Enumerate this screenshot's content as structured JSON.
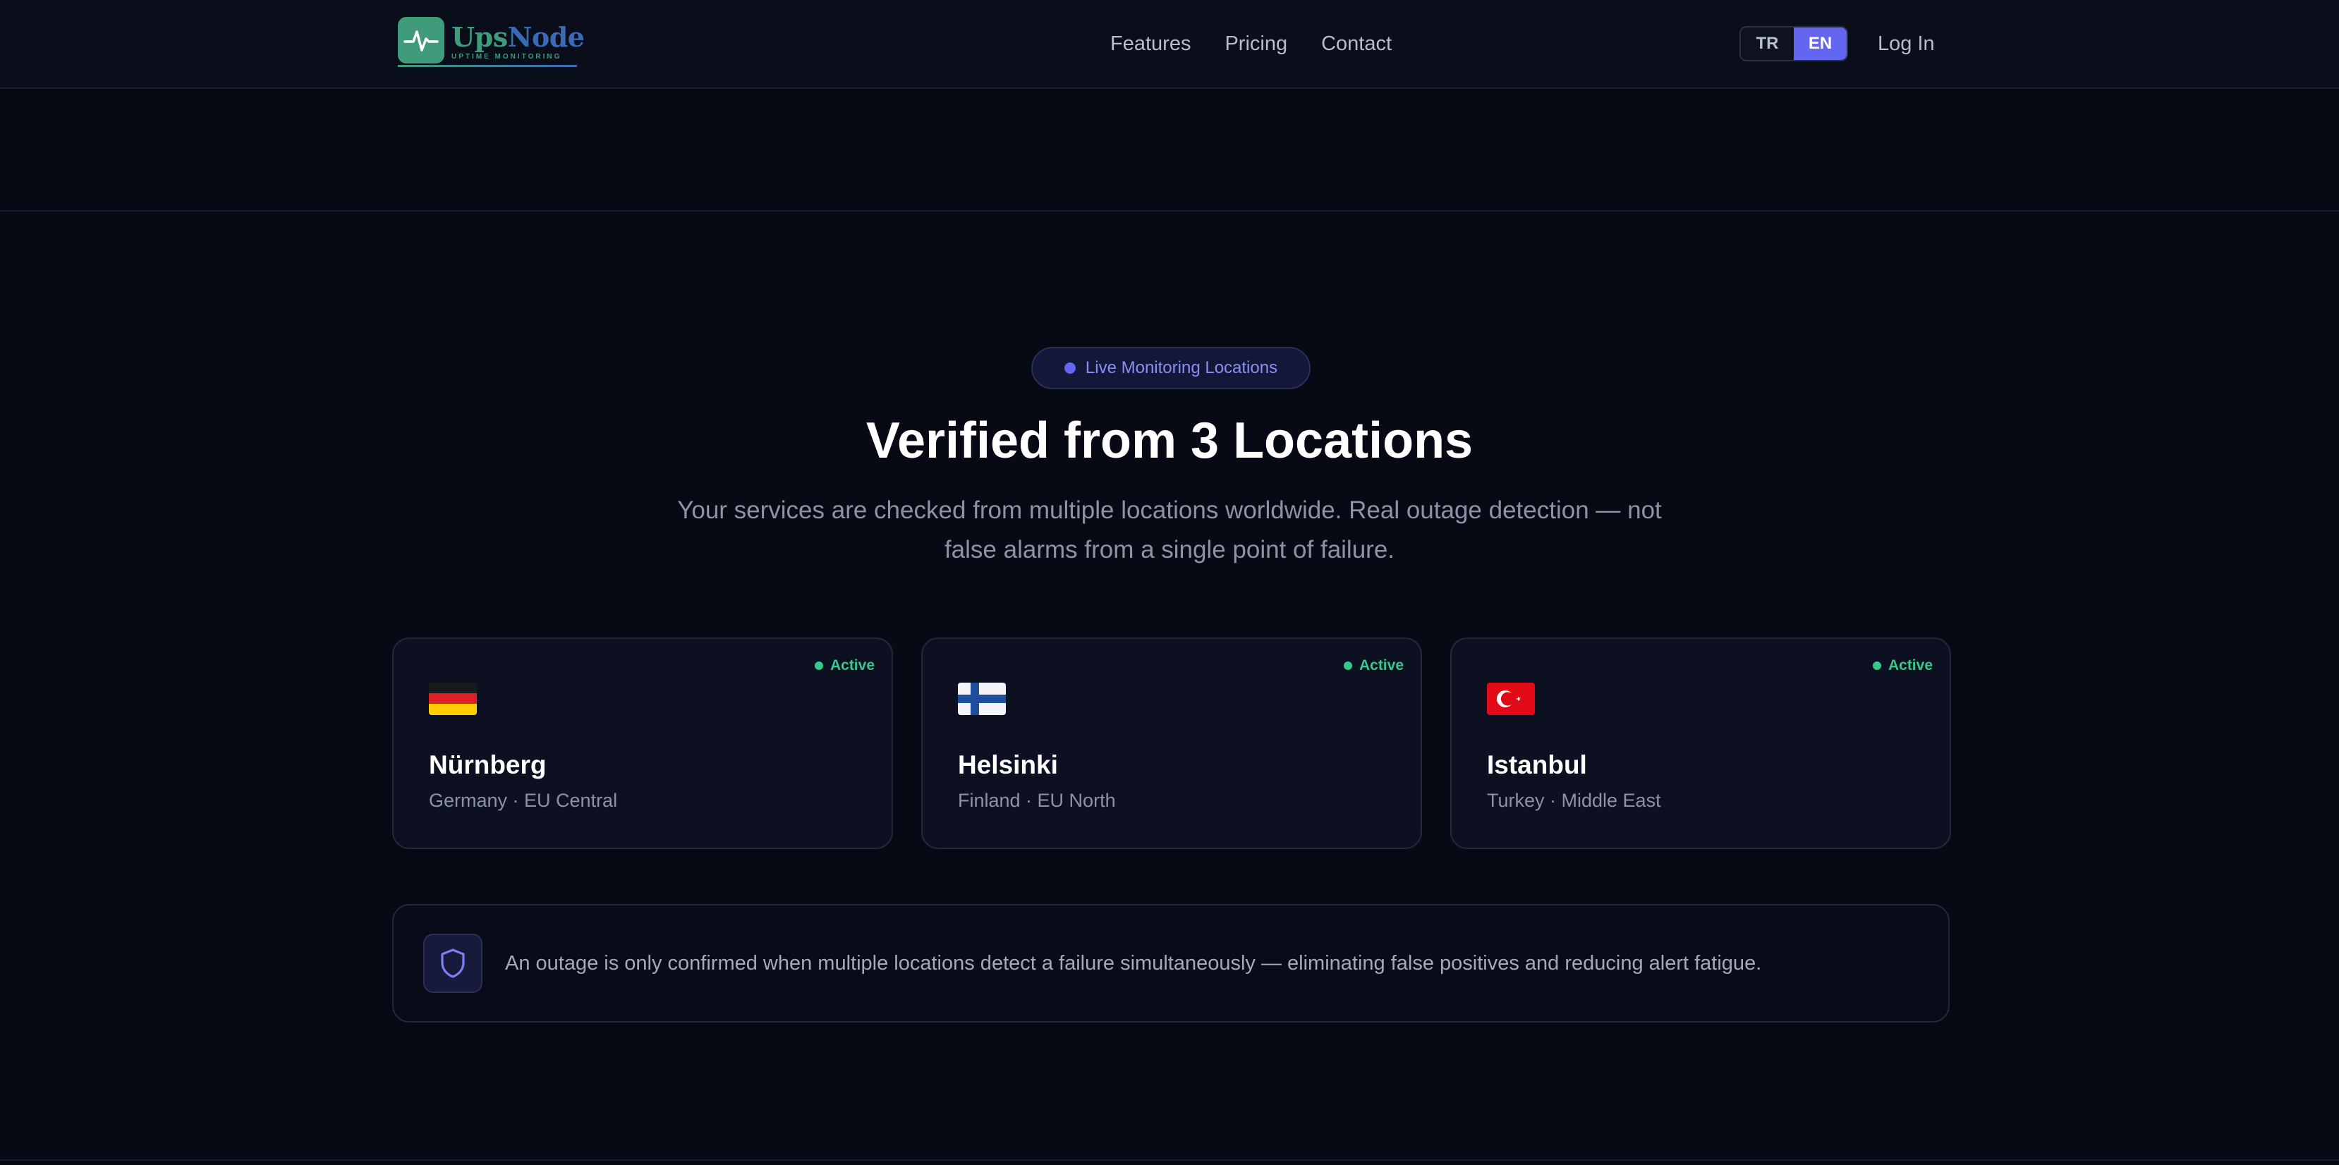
{
  "header": {
    "logo": {
      "name_part1": "Ups",
      "name_part2": "Node",
      "tagline": "UPTIME MONITORING"
    },
    "nav": [
      {
        "label": "Features"
      },
      {
        "label": "Pricing"
      },
      {
        "label": "Contact"
      }
    ],
    "language": {
      "options": [
        "TR",
        "EN"
      ],
      "selected": "EN"
    },
    "login_label": "Log In"
  },
  "hero": {
    "badge": "Live Monitoring Locations",
    "title": "Verified from 3 Locations",
    "subtitle": "Your services are checked from multiple locations worldwide. Real outage detection — not false alarms from a single point of failure."
  },
  "locations": [
    {
      "city": "Nürnberg",
      "region": "Germany · EU Central",
      "status": "Active",
      "flag": "germany-flag-icon"
    },
    {
      "city": "Helsinki",
      "region": "Finland · EU North",
      "status": "Active",
      "flag": "finland-flag-icon"
    },
    {
      "city": "Istanbul",
      "region": "Turkey · Middle East",
      "status": "Active",
      "flag": "turkey-flag-icon"
    }
  ],
  "info": {
    "icon": "shield-icon",
    "text": "An outage is only confirmed when multiple locations detect a failure simultaneously — eliminating false positives and reducing alert fatigue."
  },
  "colors": {
    "background": "#070a14",
    "accent": "#6366f1",
    "active": "#34c98b",
    "brand_green": "#3f9b7a",
    "brand_blue": "#3a6ab5"
  }
}
